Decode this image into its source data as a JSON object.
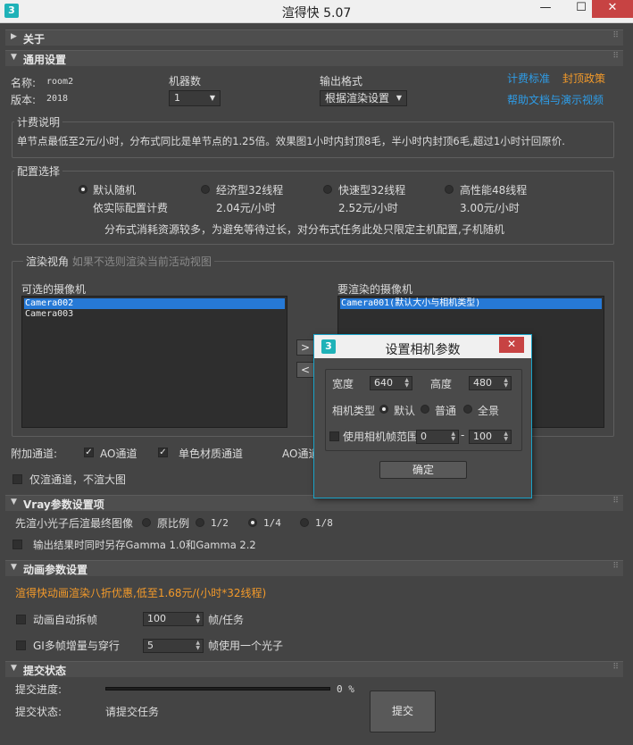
{
  "window": {
    "title": "渲得快 5.07",
    "icon_text": "3",
    "minimize": "—",
    "maximize": "☐",
    "close": "✕"
  },
  "about": {
    "label": "关于",
    "collapsed": true
  },
  "general": {
    "label": "通用设置",
    "name_label": "名称:",
    "name_value": "room2",
    "version_label": "版本:",
    "version_value": "2018",
    "machines_label": "机器数",
    "machines_value": "1",
    "output_label": "输出格式",
    "output_value": "根据渲染设置",
    "link_billing": "计费标准",
    "link_cap": "封顶政策",
    "link_help": "帮助文档与演示视频",
    "billing_group_title": "计费说明",
    "billing_text": "单节点最低至2元/小时，分布式同比是单节点的1.25倍。效果图1小时内封顶8毛，半小时内封顶6毛,超过1小时计回原价.",
    "config_group_title": "配置选择",
    "configs": [
      {
        "name": "默认随机",
        "price": "依实际配置计费",
        "selected": true
      },
      {
        "name": "经济型32线程",
        "price": "2.04元/小时",
        "selected": false
      },
      {
        "name": "快速型32线程",
        "price": "2.52元/小时",
        "selected": false
      },
      {
        "name": "高性能48线程",
        "price": "3.00元/小时",
        "selected": false
      }
    ],
    "config_note": "分布式消耗资源较多，为避免等待过长，对分布式任务此处只限定主机配置,子机随机",
    "view_group_title": "渲染视角",
    "view_group_hint": "如果不选则渲染当前活动视图",
    "available_cameras_label": "可选的摄像机",
    "available_cameras": [
      {
        "name": "Camera002",
        "selected": true
      },
      {
        "name": "Camera003",
        "selected": false
      }
    ],
    "render_cameras_label": "要渲染的摄像机",
    "render_cameras": [
      {
        "name": "Camera001(默认大小与相机类型)",
        "selected": true
      }
    ],
    "move_right": ">",
    "move_left": "<",
    "extra_channels_label": "附加通道:",
    "ao_channel_label": "AO通道",
    "ao_channel_checked": true,
    "mono_channel_label": "单色材质通道",
    "mono_channel_checked": true,
    "ao_channel_label2": "AO通道",
    "only_channels_label": "仅渲通道，不渲大图",
    "only_channels_checked": false
  },
  "vray": {
    "label": "Vray参数设置项",
    "prepass_label": "先渲小光子后渲最终图像",
    "ratios": [
      {
        "label": "原比例",
        "selected": false
      },
      {
        "label": "1/2",
        "selected": false
      },
      {
        "label": "1/4",
        "selected": true
      },
      {
        "label": "1/8",
        "selected": false
      }
    ],
    "gamma_label": "输出结果时同时另存Gamma 1.0和Gamma 2.2",
    "gamma_checked": false
  },
  "animation": {
    "label": "动画参数设置",
    "promo": "渲得快动画渲染八折优惠,低至1.68元/(小时*32线程)",
    "auto_split_label": "动画自动拆帧",
    "auto_split_value": "100",
    "auto_split_unit": "帧/任务",
    "gi_label": "GI多帧增量与穿行",
    "gi_value": "5",
    "gi_unit": "帧使用一个光子"
  },
  "submit": {
    "label": "提交状态",
    "progress_label": "提交进度:",
    "progress_percent": 0,
    "progress_text": "0 %",
    "status_label": "提交状态:",
    "status_value": "请提交任务",
    "submit_button": "提交"
  },
  "dialog": {
    "title": "设置相机参数",
    "icon_text": "3",
    "close": "✕",
    "width_label": "宽度",
    "width_value": "640",
    "height_label": "高度",
    "height_value": "480",
    "camera_type_label": "相机类型",
    "camera_types": [
      {
        "label": "默认",
        "selected": true
      },
      {
        "label": "普通",
        "selected": false
      },
      {
        "label": "全景",
        "selected": false
      }
    ],
    "frame_range_label": "使用相机帧范围",
    "frame_range_checked": false,
    "frame_from": "0",
    "frame_sep": "-",
    "frame_to": "100",
    "ok_button": "确定"
  },
  "colors": {
    "accent_blue": "#2e9de8",
    "accent_orange": "#f39a2a",
    "selection": "#2679d6",
    "close_red": "#c74343"
  }
}
